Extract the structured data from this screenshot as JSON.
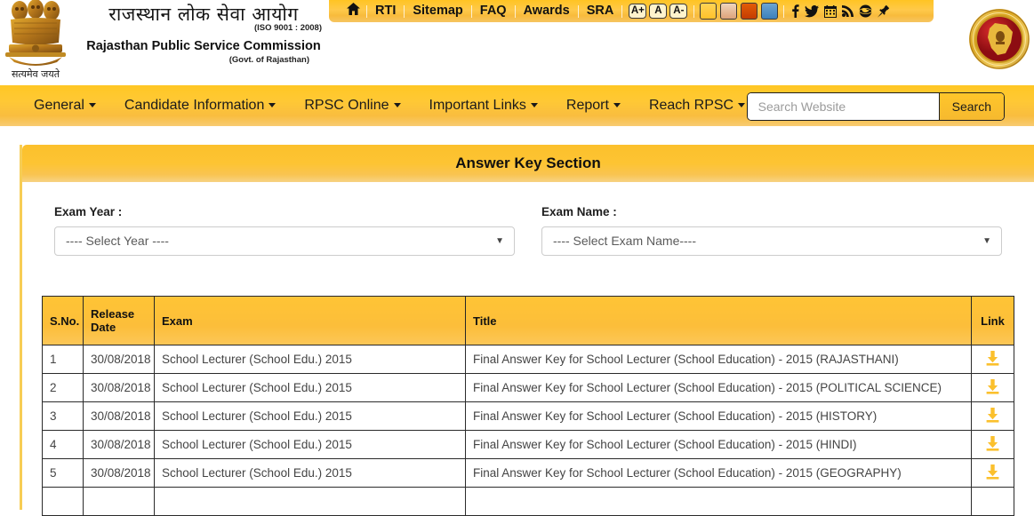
{
  "topbar": {
    "home_icon": "home-icon",
    "links": [
      "RTI",
      "Sitemap",
      "FAQ",
      "Awards",
      "SRA"
    ],
    "font_sizes": [
      "A+",
      "A",
      "A-"
    ],
    "theme_swatches": [
      "#ffc938",
      "#e3b08a",
      "#d24f06",
      "#4f92c6"
    ],
    "social": [
      "facebook-icon",
      "twitter-icon",
      "calendar-icon",
      "rss-icon",
      "globe-icon",
      "pin-icon"
    ]
  },
  "header": {
    "title_hi": "राजस्थान लोक सेवा आयोग",
    "iso": "(ISO 9001 : 2008)",
    "title_en": "Rajasthan Public Service Commission",
    "govt": "(Govt. of Rajasthan)",
    "emblem_motto": "सत्यमेव जयते",
    "emblem_name": "national-emblem",
    "seal_name": "rpsc-seal"
  },
  "nav": {
    "items": [
      "General",
      "Candidate Information",
      "RPSC Online",
      "Important Links",
      "Report",
      "Reach RPSC"
    ],
    "search_placeholder": "Search Website",
    "search_value": "",
    "search_button": "Search"
  },
  "panel": {
    "title": "Answer Key Section",
    "exam_year": {
      "label": "Exam Year :",
      "selected": "---- Select Year ----"
    },
    "exam_name": {
      "label": "Exam Name :",
      "selected": "---- Select Exam Name----"
    }
  },
  "table": {
    "headers": [
      "S.No.",
      "Release Date",
      "Exam",
      "Title",
      "Link"
    ],
    "rows": [
      {
        "sno": "1",
        "date": "30/08/2018",
        "exam": "School Lecturer (School Edu.) 2015",
        "title": "Final Answer Key for School Lecturer (School Education) - 2015 (RAJASTHANI)",
        "link": "download-icon"
      },
      {
        "sno": "2",
        "date": "30/08/2018",
        "exam": "School Lecturer (School Edu.) 2015",
        "title": "Final Answer Key for School Lecturer (School Education) - 2015 (POLITICAL SCIENCE)",
        "link": "download-icon"
      },
      {
        "sno": "3",
        "date": "30/08/2018",
        "exam": "School Lecturer (School Edu.) 2015",
        "title": "Final Answer Key for School Lecturer (School Education) - 2015 (HISTORY)",
        "link": "download-icon"
      },
      {
        "sno": "4",
        "date": "30/08/2018",
        "exam": "School Lecturer (School Edu.) 2015",
        "title": "Final Answer Key for School Lecturer (School Education) - 2015 (HINDI)",
        "link": "download-icon"
      },
      {
        "sno": "5",
        "date": "30/08/2018",
        "exam": "School Lecturer (School Edu.) 2015",
        "title": "Final Answer Key for School Lecturer (School Education) - 2015 (GEOGRAPHY)",
        "link": "download-icon"
      },
      {
        "sno": "",
        "date": "",
        "exam": "",
        "title": "",
        "link": ""
      }
    ]
  },
  "colors": {
    "brand_yellow": "#ffc423",
    "panel_header": "#fcc02c",
    "download_icon": "#fbc02d",
    "text_dark": "#111111"
  }
}
